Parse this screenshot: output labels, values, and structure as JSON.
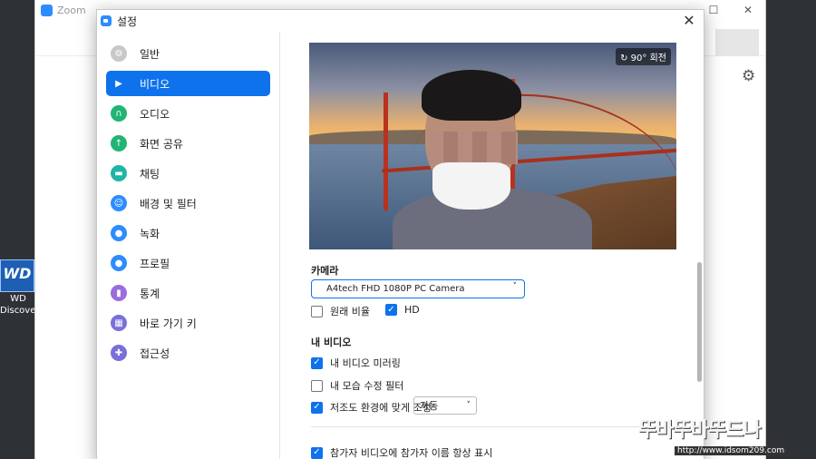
{
  "desktop": {
    "wd_icon_text": "WD",
    "wd_label_line1": "WD",
    "wd_label_line2": "Discovery"
  },
  "zoom_window": {
    "title": "Zoom",
    "controls": [
      "—",
      "☐",
      "✕"
    ]
  },
  "dialog": {
    "title": "설정",
    "close": "✕",
    "sidebar": [
      {
        "label": "일반",
        "icon": "gear-icon",
        "color": "#c8c8c8",
        "active": false
      },
      {
        "label": "비디오",
        "icon": "video-camera-icon",
        "color": "#0e72ed",
        "active": true
      },
      {
        "label": "오디오",
        "icon": "headphones-icon",
        "color": "#21b573",
        "active": false
      },
      {
        "label": "화면 공유",
        "icon": "share-screen-icon",
        "color": "#21b573",
        "active": false
      },
      {
        "label": "채팅",
        "icon": "chat-bubble-icon",
        "color": "#1fb5a5",
        "active": false
      },
      {
        "label": "배경 및 필터",
        "icon": "background-person-icon",
        "color": "#2d8cff",
        "active": false
      },
      {
        "label": "녹화",
        "icon": "record-icon",
        "color": "#2d8cff",
        "active": false
      },
      {
        "label": "프로필",
        "icon": "profile-icon",
        "color": "#2d8cff",
        "active": false
      },
      {
        "label": "통계",
        "icon": "statistics-icon",
        "color": "#9b6cdd",
        "active": false
      },
      {
        "label": "바로 가기 키",
        "icon": "keyboard-icon",
        "color": "#7a6fd8",
        "active": false
      },
      {
        "label": "접근성",
        "icon": "accessibility-icon",
        "color": "#7a6fd8",
        "active": false
      }
    ],
    "video": {
      "rotate_label": "↻ 90° 회전",
      "camera_heading": "카메라",
      "camera_value": "A4tech FHD 1080P PC Camera",
      "original_ratio_label": "원래 비율",
      "original_ratio_checked": false,
      "hd_label": "HD",
      "hd_checked": true,
      "my_video_heading": "내 비디오",
      "mirror_label": "내 비디오 미러링",
      "mirror_checked": true,
      "touchup_label": "내 모습 수정 필터",
      "touchup_checked": false,
      "lowlight_label": "저조도 환경에 맞게 조정",
      "lowlight_checked": true,
      "lowlight_mode": "자동",
      "names_label": "참가자 비디오에 참가자 이름 항상 표시",
      "names_checked": true
    }
  },
  "watermark": {
    "big": "뚜바뚜바뚜드나",
    "url": "http://www.idsom209.com"
  }
}
